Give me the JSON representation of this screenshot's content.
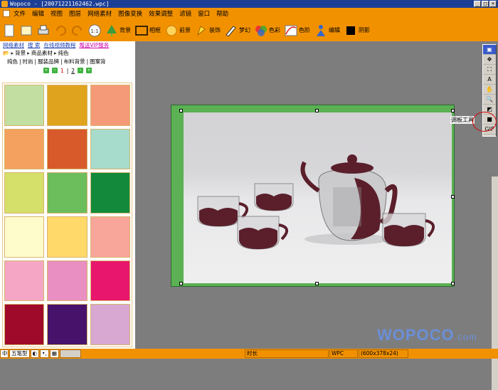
{
  "window": {
    "title": "Wopoco - [20071221162462.wpc]"
  },
  "menu": [
    "文件",
    "编辑",
    "视图",
    "图层",
    "网络素材",
    "图像变换",
    "效果调整",
    "滤镜",
    "窗口",
    "帮助"
  ],
  "toolbar": {
    "background": "背景",
    "frame": "相框",
    "foreground": "前景",
    "decorate": "装饰",
    "dream": "梦幻",
    "color": "色彩",
    "levels": "色阶",
    "edit": "编辑",
    "shadow": "阴影"
  },
  "sidebar": {
    "links": [
      "网络素材",
      "搜 索",
      "在线视频教程"
    ],
    "promo": "赠送VIP服务",
    "breadcrumb": [
      "背景",
      "商品素材",
      "纯色"
    ],
    "tags": [
      "纯色",
      "时尚",
      "服装品牌",
      "布料背景",
      "图案背"
    ],
    "pager": {
      "pages": [
        "1",
        "2"
      ]
    },
    "swatches": [
      "#c2dea1",
      "#e0a31e",
      "#f59a78",
      "#f4a05e",
      "#d85a2a",
      "#a7dccc",
      "#d5e06a",
      "#6cbd5c",
      "#138a3b",
      "#fffccc",
      "#ffd96a",
      "#f8a59a",
      "#f5a6c5",
      "#e98fc1",
      "#e8176d",
      "#a00a2a",
      "#47136a",
      "#d8a8d2"
    ]
  },
  "canvas": {
    "tooltip": "调板工具"
  },
  "tools": [
    "▣",
    "✥",
    "⛶",
    "A",
    "✋",
    "🔍",
    "◩",
    "■",
    "GIF"
  ],
  "status": {
    "input": "五笔型",
    "duration": "时长",
    "format": "WPC",
    "size": "(600x378x24)"
  },
  "watermark": {
    "brand": "WOPOCO",
    "suffix": ".com"
  },
  "colors": {
    "orange": "#f29100",
    "frameGreen": "#5bb153",
    "titleBlue": "#1c3f96"
  }
}
